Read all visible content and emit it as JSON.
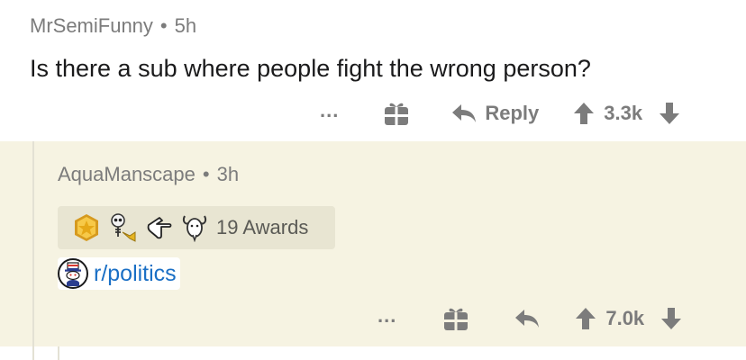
{
  "comment": {
    "author": "MrSemiFunny",
    "age": "5h",
    "body": "Is there a sub where people fight the wrong person?",
    "actions": {
      "more": "...",
      "reply_label": "Reply",
      "score": "3.3k"
    }
  },
  "reply": {
    "author": "AquaManscape",
    "age": "3h",
    "awards_label": "19 Awards",
    "awards_icons": [
      "gold-medal-icon",
      "skeleton-trumpet-icon",
      "pointing-hand-icon",
      "goat-icon"
    ],
    "flair": "r/politics",
    "actions": {
      "more": "...",
      "score": "7.0k"
    }
  },
  "separator": "•",
  "colors": {
    "reply_bg": "#f6f3e2",
    "link": "#1a6fc5",
    "meta": "#7c7c7c"
  }
}
